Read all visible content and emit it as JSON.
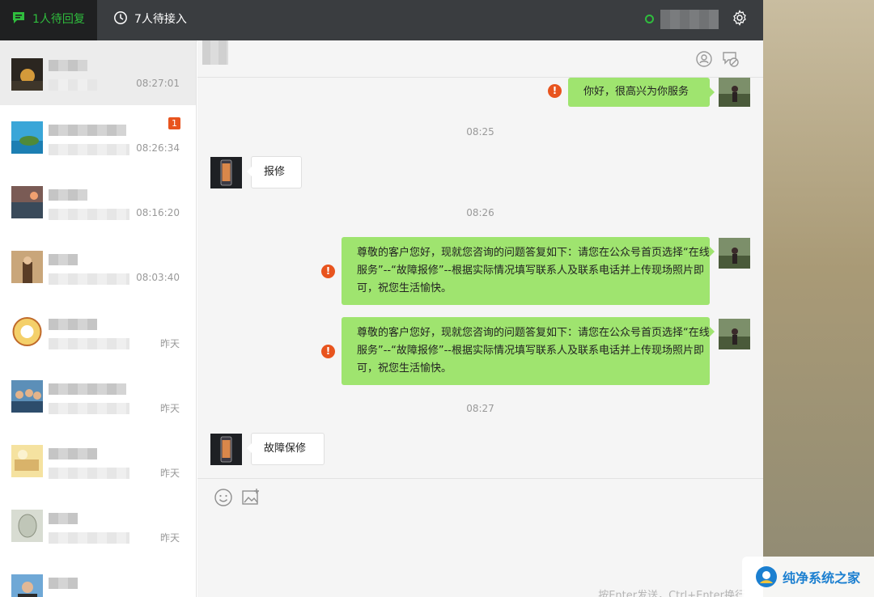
{
  "topbar": {
    "tab_pending_reply": "1人待回复",
    "tab_pending_accept": "7人待接入",
    "accent_color": "#2fbd3d"
  },
  "sidebar": {
    "conversations": [
      {
        "time": "08:27:01",
        "active": true,
        "badge": ""
      },
      {
        "time": "08:26:34",
        "active": false,
        "badge": "1"
      },
      {
        "time": "08:16:20",
        "active": false,
        "badge": ""
      },
      {
        "time": "08:03:40",
        "active": false,
        "badge": ""
      },
      {
        "time": "昨天",
        "active": false,
        "badge": ""
      },
      {
        "time": "昨天",
        "active": false,
        "badge": ""
      },
      {
        "time": "昨天",
        "active": false,
        "badge": ""
      },
      {
        "time": "昨天",
        "active": false,
        "badge": ""
      },
      {
        "time": "",
        "active": false,
        "badge": ""
      }
    ]
  },
  "chat": {
    "messages": [
      {
        "type": "out",
        "text": "你好，很高兴为你服务",
        "failed": true
      },
      {
        "type": "timestamp",
        "text": "08:25"
      },
      {
        "type": "in",
        "text": "报修"
      },
      {
        "type": "timestamp",
        "text": "08:26"
      },
      {
        "type": "out",
        "text": "尊敬的客户您好，现就您咨询的问题答复如下：请您在公众号首页选择“在线服务”--“故障报修”--根据实际情况填写联系人及联系电话并上传现场照片即可，祝您生活愉快。",
        "failed": true
      },
      {
        "type": "out",
        "text": "尊敬的客户您好，现就您咨询的问题答复如下：请您在公众号首页选择“在线服务”--“故障报修”--根据实际情况填写联系人及联系电话并上传现场照片即可，祝您生活愉快。",
        "failed": true
      },
      {
        "type": "timestamp",
        "text": "08:27"
      },
      {
        "type": "in",
        "text": "故障保修"
      }
    ],
    "send_hint": "按Enter发送，Ctrl+Enter换行"
  },
  "watermark": {
    "text": "纯净系统之家"
  }
}
